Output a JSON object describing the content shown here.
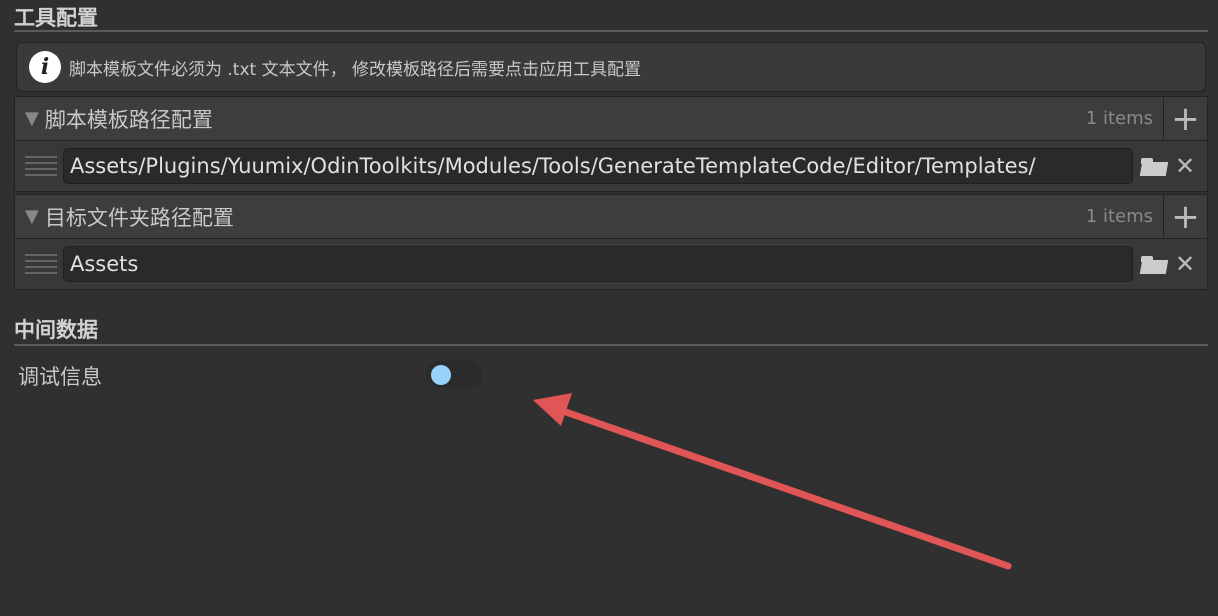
{
  "section1": {
    "title": "工具配置",
    "info": "脚本模板文件必须为 .txt 文本文件， 修改模板路径后需要点击应用工具配置"
  },
  "lists": [
    {
      "title": "脚本模板路径配置",
      "count": "1 items",
      "value": "Assets/Plugins/Yuumix/OdinToolkits/Modules/Tools/GenerateTemplateCode/Editor/Templates/"
    },
    {
      "title": "目标文件夹路径配置",
      "count": "1 items",
      "value": "Assets"
    }
  ],
  "section2": {
    "title": "中间数据",
    "debug_label": "调试信息",
    "debug_enabled": false
  },
  "colors": {
    "arrow": "#e05555",
    "toggle_knob": "#96d2fa"
  }
}
